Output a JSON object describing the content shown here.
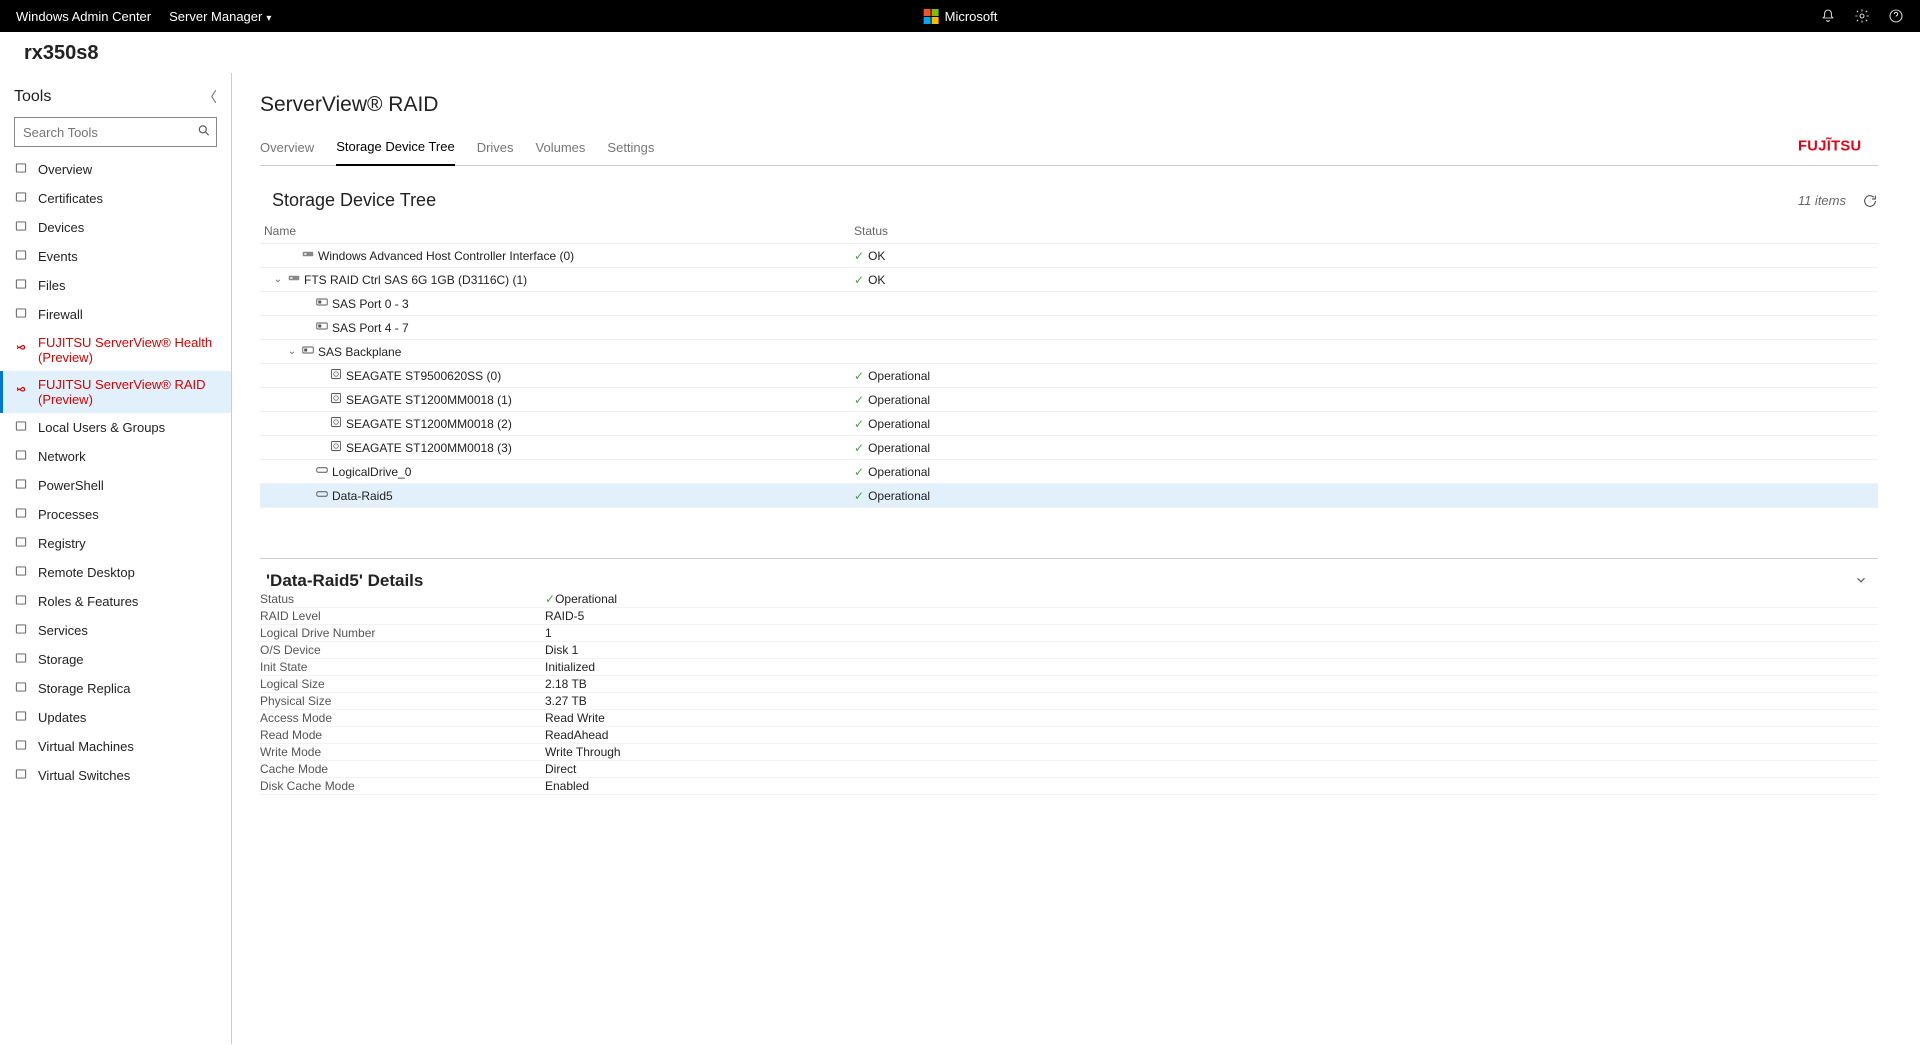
{
  "topbar": {
    "app_name": "Windows Admin Center",
    "server_manager": "Server Manager",
    "brand": "Microsoft"
  },
  "server_name": "rx350s8",
  "sidebar": {
    "title": "Tools",
    "search_placeholder": "Search Tools",
    "items": [
      {
        "label": "Overview"
      },
      {
        "label": "Certificates"
      },
      {
        "label": "Devices"
      },
      {
        "label": "Events"
      },
      {
        "label": "Files"
      },
      {
        "label": "Firewall"
      },
      {
        "label": "FUJITSU ServerView® Health (Preview)",
        "fujitsu": true
      },
      {
        "label": "FUJITSU ServerView® RAID (Preview)",
        "fujitsu": true,
        "active": true
      },
      {
        "label": "Local Users & Groups"
      },
      {
        "label": "Network"
      },
      {
        "label": "PowerShell"
      },
      {
        "label": "Processes"
      },
      {
        "label": "Registry"
      },
      {
        "label": "Remote Desktop"
      },
      {
        "label": "Roles & Features"
      },
      {
        "label": "Services"
      },
      {
        "label": "Storage"
      },
      {
        "label": "Storage Replica"
      },
      {
        "label": "Updates"
      },
      {
        "label": "Virtual Machines"
      },
      {
        "label": "Virtual Switches"
      }
    ]
  },
  "page": {
    "title": "ServerView® RAID",
    "tabs": [
      "Overview",
      "Storage Device Tree",
      "Drives",
      "Volumes",
      "Settings"
    ],
    "active_tab": "Storage Device Tree",
    "vendor": "FUJITSU"
  },
  "tree": {
    "section_title": "Storage Device Tree",
    "items_count": "11 items",
    "headers": {
      "name": "Name",
      "status": "Status"
    },
    "rows": [
      {
        "indent": 1,
        "icon": "controller",
        "name": "Windows Advanced Host Controller Interface (0)",
        "status": "OK"
      },
      {
        "indent": 0,
        "icon": "controller",
        "expand": "open",
        "name": "FTS RAID Ctrl SAS 6G 1GB (D3116C) (1)",
        "status": "OK"
      },
      {
        "indent": 2,
        "icon": "port",
        "name": "SAS Port 0 - 3",
        "status": ""
      },
      {
        "indent": 2,
        "icon": "port",
        "name": "SAS Port 4 - 7",
        "status": ""
      },
      {
        "indent": 1,
        "icon": "port",
        "expand": "open",
        "name": "SAS Backplane",
        "status": ""
      },
      {
        "indent": 3,
        "icon": "disk",
        "name": "SEAGATE ST9500620SS (0)",
        "status": "Operational"
      },
      {
        "indent": 3,
        "icon": "disk",
        "name": "SEAGATE ST1200MM0018 (1)",
        "status": "Operational"
      },
      {
        "indent": 3,
        "icon": "disk",
        "name": "SEAGATE ST1200MM0018 (2)",
        "status": "Operational"
      },
      {
        "indent": 3,
        "icon": "disk",
        "name": "SEAGATE ST1200MM0018 (3)",
        "status": "Operational"
      },
      {
        "indent": 2,
        "icon": "ld",
        "name": "LogicalDrive_0",
        "status": "Operational"
      },
      {
        "indent": 2,
        "icon": "ld",
        "name": "Data-Raid5",
        "status": "Operational",
        "selected": true
      }
    ]
  },
  "details": {
    "title": "'Data-Raid5' Details",
    "rows": [
      {
        "label": "Status",
        "value": "Operational",
        "check": true
      },
      {
        "label": "RAID Level",
        "value": "RAID-5"
      },
      {
        "label": "Logical Drive Number",
        "value": "1"
      },
      {
        "label": "O/S Device",
        "value": "Disk 1"
      },
      {
        "label": "Init State",
        "value": "Initialized"
      },
      {
        "label": "Logical Size",
        "value": "2.18 TB"
      },
      {
        "label": "Physical Size",
        "value": "3.27 TB"
      },
      {
        "label": "Access Mode",
        "value": "Read Write"
      },
      {
        "label": "Read Mode",
        "value": "ReadAhead"
      },
      {
        "label": "Write Mode",
        "value": "Write Through"
      },
      {
        "label": "Cache Mode",
        "value": "Direct"
      },
      {
        "label": "Disk Cache Mode",
        "value": "Enabled"
      }
    ]
  }
}
